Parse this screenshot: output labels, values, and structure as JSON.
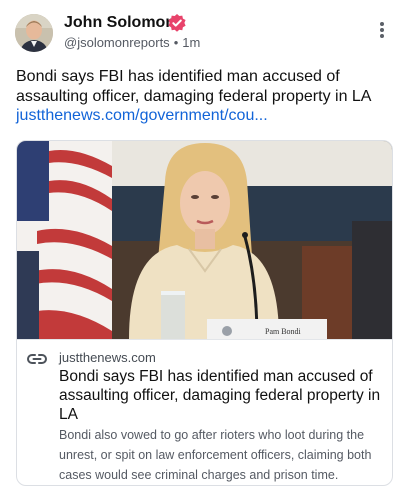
{
  "post": {
    "author_name": "John Solomon",
    "handle": "@jsolomonreports",
    "separator": "•",
    "time": "1m",
    "text": "Bondi says FBI has identified man accused of assaulting officer, damaging federal property in LA",
    "link_text": "justthenews.com/government/cou..."
  },
  "card": {
    "domain": "justthenews.com",
    "title": "Bondi says FBI has identified man accused of assaulting officer, damaging federal property in LA",
    "description": "Bondi also vowed to go after rioters who loot during the unrest, or spit on law enforcement officers, claiming both cases would see criminal charges and prison time.",
    "nameplate_text": "Pam Bondi"
  },
  "icons": {
    "verified": "verified-badge-icon",
    "more": "more-options-icon",
    "link": "link-icon"
  },
  "colors": {
    "link": "#1264d8",
    "verified": "#e8436b",
    "text": "#111111",
    "muted": "#555a63",
    "border": "#dcdfe4"
  }
}
